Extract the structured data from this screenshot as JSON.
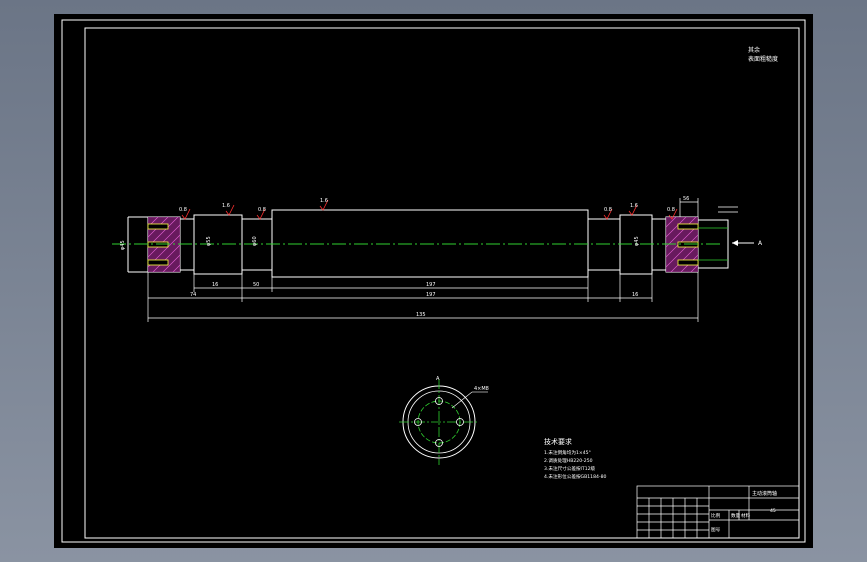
{
  "drawing": {
    "title_note_line1": "其余",
    "title_note_line2": "表面粗糙度",
    "dimensions": {
      "d_left_end": "φ45",
      "d_bearing_left": "φ55",
      "d_shoulder": "φ60",
      "d_right_end": "φ45",
      "l_left_journal": "16",
      "l_left_step": "50",
      "l_body": "197",
      "l_total_top": "197",
      "l_right_step": "16",
      "l_left_outer": "74",
      "l_overall": "135",
      "l_keyway": "56"
    },
    "roughness": {
      "r1": "0.8",
      "r2": "1.6",
      "r3": "0.8",
      "r4": "1.6",
      "r5": "0.8",
      "r6": "1.6",
      "r7": "0.8"
    },
    "arrow_label": "A",
    "section_label": "A",
    "section_note": "4×M8",
    "tech_requirements": {
      "heading": "技术要求",
      "items": [
        "1.未注倒角均为1×45°",
        "2.调质处理HB220-250",
        "3.未注尺寸公差按IT12级",
        "4.未注形位公差按GB1184-80"
      ]
    },
    "title_block": {
      "part_name": "主动滚筒轴",
      "cells": [
        "比例",
        "数量",
        "材料",
        "图号"
      ],
      "material": "45"
    }
  }
}
